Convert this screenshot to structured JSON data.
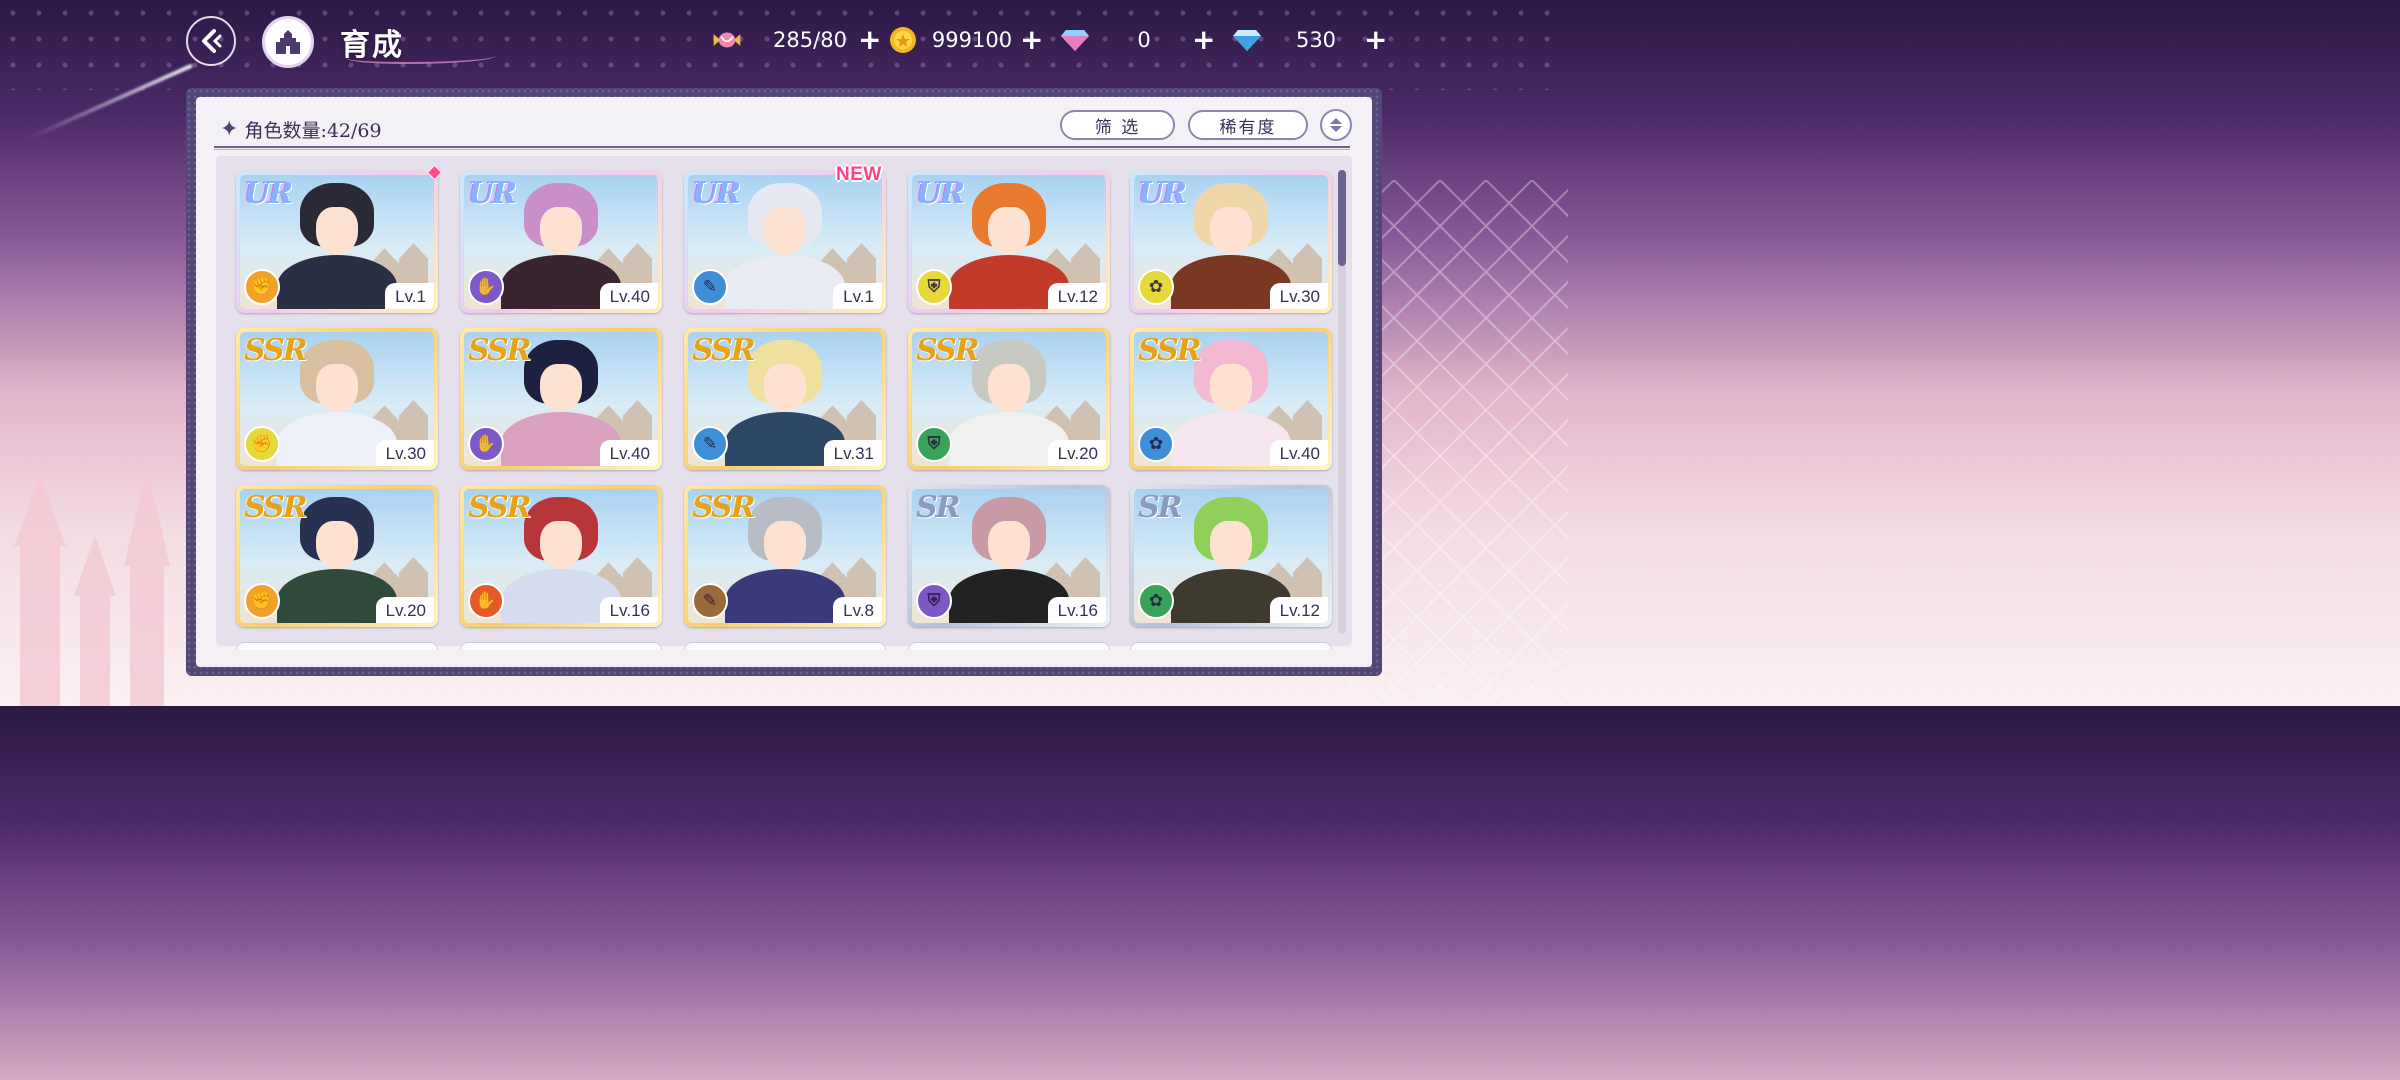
{
  "header": {
    "title": "育成",
    "resources": [
      {
        "icon": "candy-icon",
        "value": "285/80"
      },
      {
        "icon": "gold-coin-icon",
        "value": "999100"
      },
      {
        "icon": "pink-gem-icon",
        "value": "0"
      },
      {
        "icon": "blue-diamond-icon",
        "value": "530"
      }
    ],
    "plus": "+"
  },
  "panel": {
    "count_label": "角色数量:42/69",
    "filter_label": "筛 选",
    "rarity_label": "稀有度",
    "new_badge": "NEW"
  },
  "cards": [
    {
      "rarity": "UR",
      "level": "Lv.1",
      "attr_color": "#f2a12a",
      "hair": "#2a2a36",
      "outfit": "#2b2f45"
    },
    {
      "rarity": "UR",
      "level": "Lv.40",
      "attr_color": "#7d58c7",
      "hair": "#c88fc8",
      "outfit": "#3a2430"
    },
    {
      "rarity": "UR",
      "level": "Lv.1",
      "attr_color": "#3f8fd8",
      "hair": "#e6e9f2",
      "outfit": "#e9ecf4"
    },
    {
      "rarity": "UR",
      "level": "Lv.12",
      "attr_color": "#e6d93a",
      "hair": "#e87a2e",
      "outfit": "#c13a2a"
    },
    {
      "rarity": "UR",
      "level": "Lv.30",
      "attr_color": "#e6d93a",
      "hair": "#efd6a8",
      "outfit": "#7a3822"
    },
    {
      "rarity": "SSR",
      "level": "Lv.30",
      "attr_color": "#e6d93a",
      "hair": "#d8c0a0",
      "outfit": "#eef0fa"
    },
    {
      "rarity": "SSR",
      "level": "Lv.40",
      "attr_color": "#7d58c7",
      "hair": "#1e2040",
      "outfit": "#d9a0c0"
    },
    {
      "rarity": "SSR",
      "level": "Lv.31",
      "attr_color": "#3f8fd8",
      "hair": "#f0e0a0",
      "outfit": "#2d4766"
    },
    {
      "rarity": "SSR",
      "level": "Lv.20",
      "attr_color": "#3aa35a",
      "hair": "#c9c9c4",
      "outfit": "#f0f0ef"
    },
    {
      "rarity": "SSR",
      "level": "Lv.40",
      "attr_color": "#3f8fd8",
      "hair": "#f3b8d2",
      "outfit": "#f6e6f0"
    },
    {
      "rarity": "SSR",
      "level": "Lv.20",
      "attr_color": "#f2a12a",
      "hair": "#283250",
      "outfit": "#2f4a3a"
    },
    {
      "rarity": "SSR",
      "level": "Lv.16",
      "attr_color": "#e65a2a",
      "hair": "#b8353a",
      "outfit": "#d6dcf0"
    },
    {
      "rarity": "SSR",
      "level": "Lv.8",
      "attr_color": "#9a6a3a",
      "hair": "#b8bcc4",
      "outfit": "#3a3a7a"
    },
    {
      "rarity": "SR",
      "level": "Lv.16",
      "attr_color": "#7d58c7",
      "hair": "#c79aa6",
      "outfit": "#222222"
    },
    {
      "rarity": "SR",
      "level": "Lv.12",
      "attr_color": "#3aa35a",
      "hair": "#8fd05a",
      "outfit": "#3f3a30"
    }
  ]
}
